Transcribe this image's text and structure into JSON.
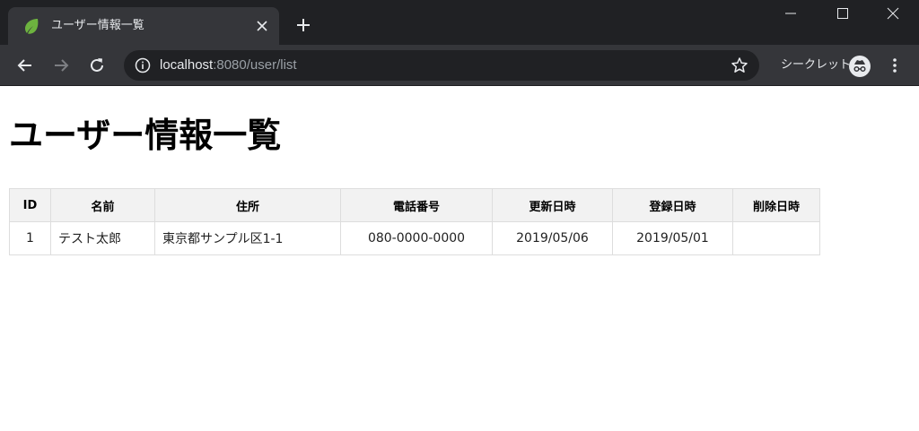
{
  "browser": {
    "tab": {
      "title": "ユーザー情報一覧",
      "favicon": "spring-leaf-icon"
    },
    "url": {
      "host": "localhost",
      "rest": ":8080/user/list"
    },
    "incognito_label": "シークレット",
    "colors": {
      "titlebar": "#202124",
      "toolbar": "#35363a",
      "omnibox": "#202124",
      "favicon": "#6db33f"
    }
  },
  "page": {
    "heading": "ユーザー情報一覧",
    "table": {
      "headers": [
        "ID",
        "名前",
        "住所",
        "電話番号",
        "更新日時",
        "登録日時",
        "削除日時"
      ],
      "rows": [
        [
          "1",
          "テスト太郎",
          "東京都サンプル区1-1",
          "080-0000-0000",
          "2019/05/06",
          "2019/05/01",
          ""
        ]
      ]
    }
  }
}
